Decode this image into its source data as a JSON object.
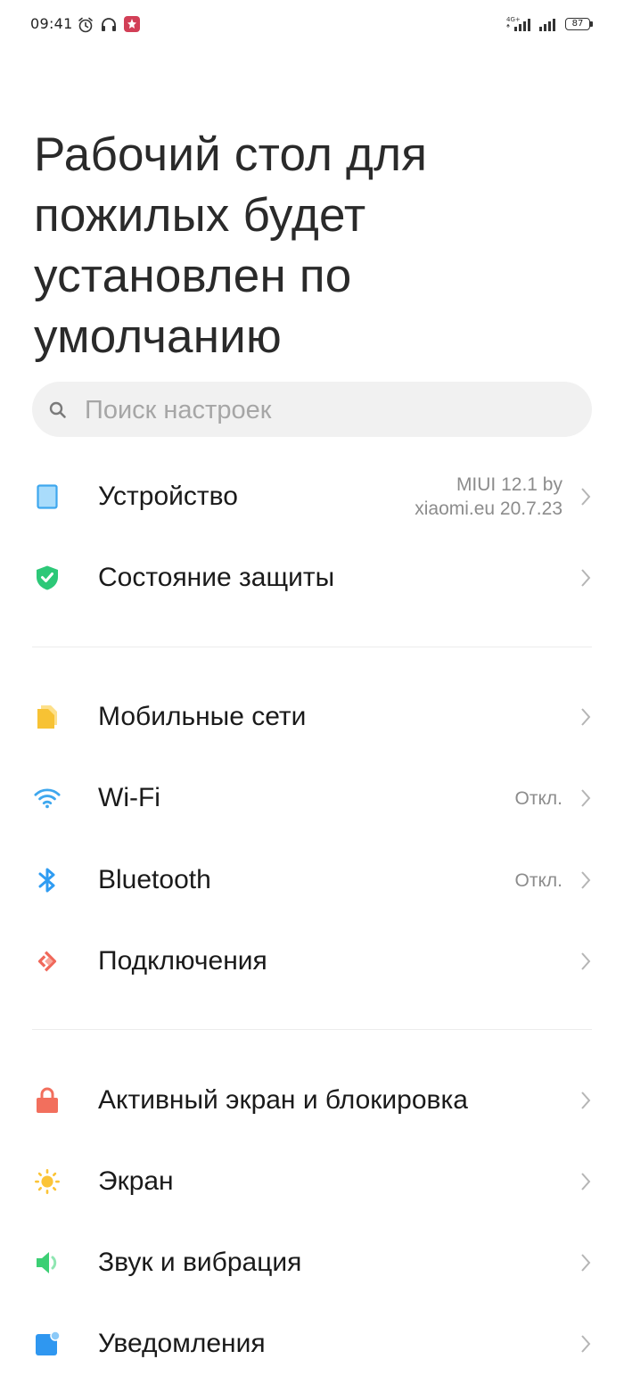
{
  "status_bar": {
    "time": "09:41",
    "network_label": "4G+",
    "battery": "87"
  },
  "title": "Рабочий стол для пожилых будет установлен по умолчанию",
  "search": {
    "placeholder": "Поиск настроек"
  },
  "groups": [
    {
      "items": [
        {
          "label": "Устройство",
          "value_line1": "MIUI 12.1 by",
          "value_line2": "xiaomi.eu 20.7.23",
          "icon": "tablet-icon",
          "color": "#3ea7ee"
        },
        {
          "label": "Состояние защиты",
          "icon": "shield-check-icon",
          "color": "#2dc878"
        }
      ]
    },
    {
      "items": [
        {
          "label": "Мобильные сети",
          "icon": "sim-card-icon",
          "color": "#f7c234"
        },
        {
          "label": "Wi-Fi",
          "value": "Откл.",
          "icon": "wifi-icon",
          "color": "#3ea7ee"
        },
        {
          "label": "Bluetooth",
          "value": "Откл.",
          "icon": "bluetooth-icon",
          "color": "#2f9cf2"
        },
        {
          "label": "Подключения",
          "icon": "connection-share-icon",
          "color": "#f0685a"
        }
      ]
    },
    {
      "items": [
        {
          "label": "Активный экран и блокировка",
          "icon": "lock-icon",
          "color": "#f26f5d"
        },
        {
          "label": "Экран",
          "icon": "sun-icon",
          "color": "#fbc437"
        },
        {
          "label": "Звук и вибрация",
          "icon": "speaker-icon",
          "color": "#3ccf74"
        },
        {
          "label": "Уведомления",
          "icon": "notification-icon",
          "color": "#2f97f0"
        }
      ]
    }
  ]
}
